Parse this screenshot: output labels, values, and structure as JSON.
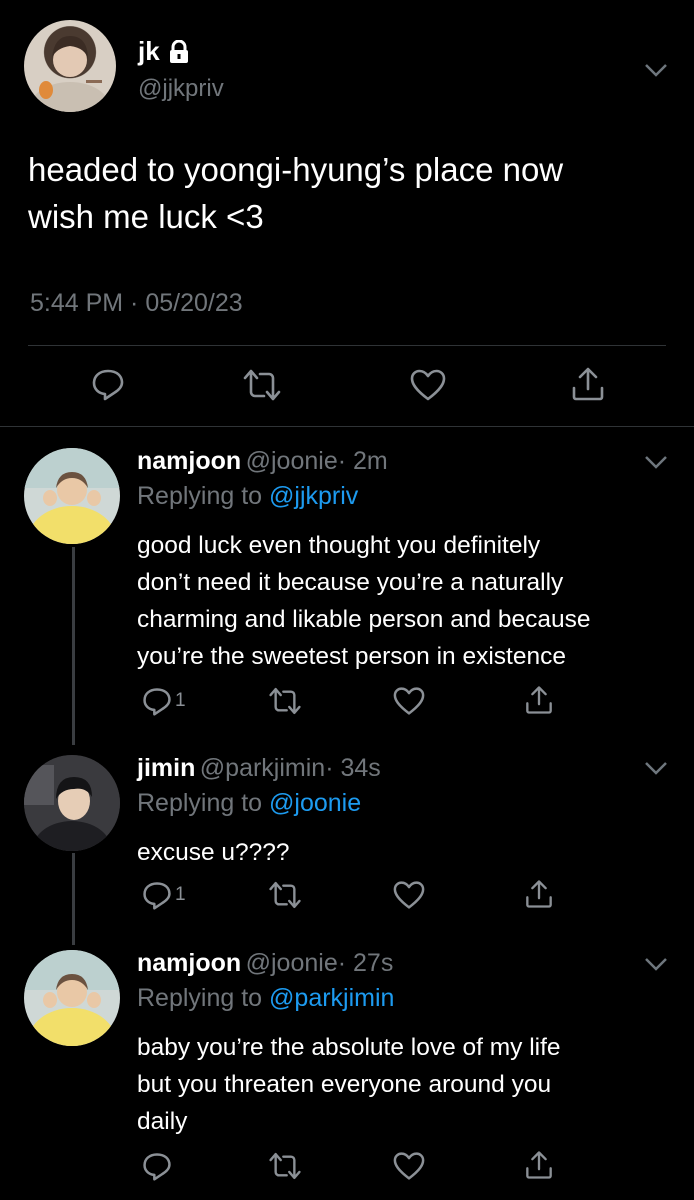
{
  "main_tweet": {
    "display_name": "jk",
    "handle": "@jjkpriv",
    "text_lines": [
      "headed to yoongi-hyung’s place now",
      "wish me luck <3"
    ],
    "timestamp": "5:44 PM · 05/20/23"
  },
  "replies": [
    {
      "display_name": "namjoon",
      "handle": "@joonie",
      "time": "· 2m",
      "replying_prefix": "Replying to ",
      "replying_to": "@jjkpriv",
      "text_lines": [
        "good luck even thought you definitely",
        "don’t need it because you’re a naturally",
        "charming and likable person and because",
        "you’re the sweetest person in existence"
      ],
      "reply_count": "1"
    },
    {
      "display_name": "jimin",
      "handle": "@parkjimin",
      "time": "· 34s",
      "replying_prefix": "Replying to ",
      "replying_to": "@joonie",
      "text_lines": [
        "excuse u????"
      ],
      "reply_count": "1"
    },
    {
      "display_name": "namjoon",
      "handle": "@joonie",
      "time": "· 27s",
      "replying_prefix": "Replying to ",
      "replying_to": "@parkjimin",
      "text_lines": [
        "baby you’re the absolute love of my life",
        "but you threaten everyone around you",
        "daily"
      ],
      "reply_count": ""
    }
  ],
  "icons": [
    "lock-icon",
    "chevron-down-icon",
    "reply-icon",
    "retweet-icon",
    "like-icon",
    "share-icon"
  ],
  "colors": {
    "background": "#000000",
    "link": "#1d9bf0",
    "secondary": "#71767b"
  }
}
